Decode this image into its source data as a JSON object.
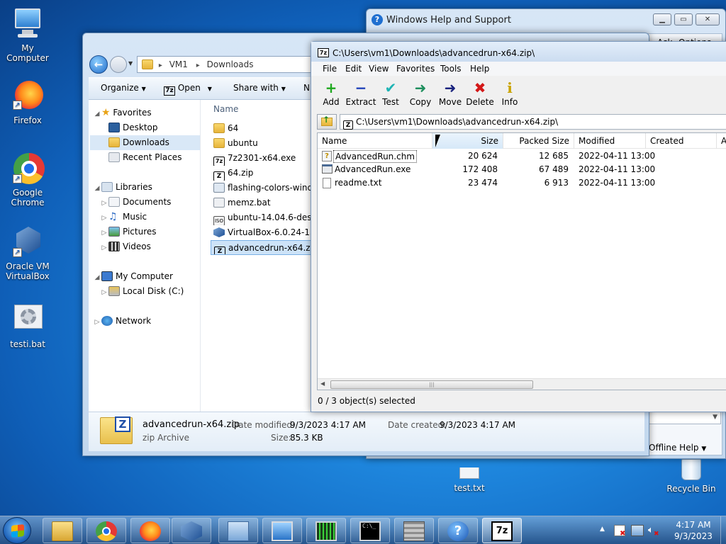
{
  "desktop": {
    "icons": [
      {
        "label": "My Computer"
      },
      {
        "label": "Firefox"
      },
      {
        "label": "Google Chrome"
      },
      {
        "label": "Oracle VM VirtualBox"
      },
      {
        "label": "testi.bat"
      }
    ],
    "test_txt": "test.txt",
    "recycle_bin": "Recycle Bin"
  },
  "help_window": {
    "title": "Windows Help and Support",
    "ask_label": "Ask",
    "options_label": "Options",
    "offline_help": "Offline Help"
  },
  "explorer": {
    "breadcrumb": [
      "VM1",
      "Downloads"
    ],
    "toolbar": {
      "organize": "Organize",
      "open": "Open",
      "share_with": "Share with",
      "next": "N"
    },
    "nav": {
      "favorites": "Favorites",
      "desktop": "Desktop",
      "downloads": "Downloads",
      "recent": "Recent Places",
      "libraries": "Libraries",
      "documents": "Documents",
      "music": "Music",
      "pictures": "Pictures",
      "videos": "Videos",
      "computer": "My Computer",
      "local_disk": "Local Disk (C:)",
      "network": "Network"
    },
    "column_name": "Name",
    "files": [
      "64",
      "ubuntu",
      "7z2301-x64.exe",
      "64.zip",
      "flashing-colors-windo",
      "memz.bat",
      "ubuntu-14.04.6-deskto",
      "VirtualBox-6.0.24-1391",
      "advancedrun-x64.zip"
    ],
    "details": {
      "name": "advancedrun-x64.zip",
      "type": "zip Archive",
      "date_modified_label": "Date modified:",
      "date_modified": "9/3/2023 4:17 AM",
      "date_created_label": "Date created:",
      "date_created": "9/3/2023 4:17 AM",
      "size_label": "Size:",
      "size": "85.3 KB"
    }
  },
  "sevenzip": {
    "title": "C:\\Users\\vm1\\Downloads\\advancedrun-x64.zip\\",
    "menu": [
      "File",
      "Edit",
      "View",
      "Favorites",
      "Tools",
      "Help"
    ],
    "toolbar": [
      {
        "label": "Add",
        "color": "#1ea81e",
        "glyph": "+"
      },
      {
        "label": "Extract",
        "color": "#1c3fb8",
        "glyph": "−"
      },
      {
        "label": "Test",
        "color": "#1fb4b4",
        "glyph": "✔"
      },
      {
        "label": "Copy",
        "color": "#1f8f5e",
        "glyph": "➜"
      },
      {
        "label": "Move",
        "color": "#1a237e",
        "glyph": "➜"
      },
      {
        "label": "Delete",
        "color": "#d31818",
        "glyph": "✖"
      },
      {
        "label": "Info",
        "color": "#c9a300",
        "glyph": "i"
      }
    ],
    "address": "C:\\Users\\vm1\\Downloads\\advancedrun-x64.zip\\",
    "columns": {
      "name": "Name",
      "size": "Size",
      "packed": "Packed Size",
      "modified": "Modified",
      "created": "Created",
      "attr": "A"
    },
    "rows": [
      {
        "name": "AdvancedRun.chm",
        "size": "20 624",
        "packed": "12 685",
        "modified": "2022-04-11 13:00"
      },
      {
        "name": "AdvancedRun.exe",
        "size": "172 408",
        "packed": "67 489",
        "modified": "2022-04-11 13:00"
      },
      {
        "name": "readme.txt",
        "size": "23 474",
        "packed": "6 913",
        "modified": "2022-04-11 13:00"
      }
    ],
    "status": "0 / 3 object(s) selected"
  },
  "clock": {
    "time": "4:17 AM",
    "date": "9/3/2023"
  }
}
